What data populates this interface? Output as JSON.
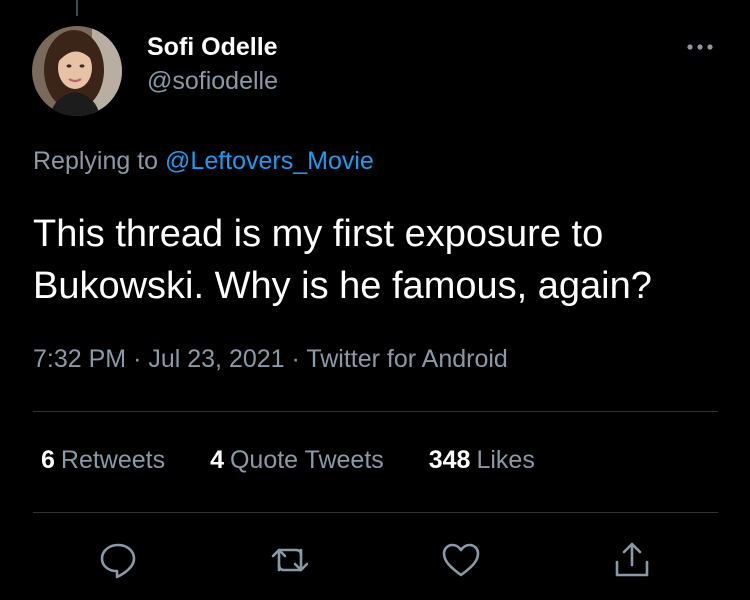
{
  "author": {
    "display_name": "Sofi Odelle",
    "handle": "@sofiodelle",
    "avatar_icon": "profile-photo"
  },
  "reply": {
    "prefix": "Replying to",
    "mention": "@Leftovers_Movie"
  },
  "tweet": {
    "text": "This thread is my first exposure to Bukowski. Why is he famous, again?",
    "time": "7:32 PM",
    "separator": "·",
    "date": "Jul 23, 2021",
    "source": "Twitter for Android"
  },
  "stats": {
    "retweets_count": "6",
    "retweets_label": "Retweets",
    "quotes_count": "4",
    "quotes_label": "Quote Tweets",
    "likes_count": "348",
    "likes_label": "Likes"
  },
  "actions": [
    "reply-icon",
    "retweet-icon",
    "like-icon",
    "share-icon"
  ],
  "colors": {
    "background": "#000000",
    "text": "#ffffff",
    "secondary": "#8b98a5",
    "link": "#1d9bf0",
    "divider": "#2f3336"
  }
}
